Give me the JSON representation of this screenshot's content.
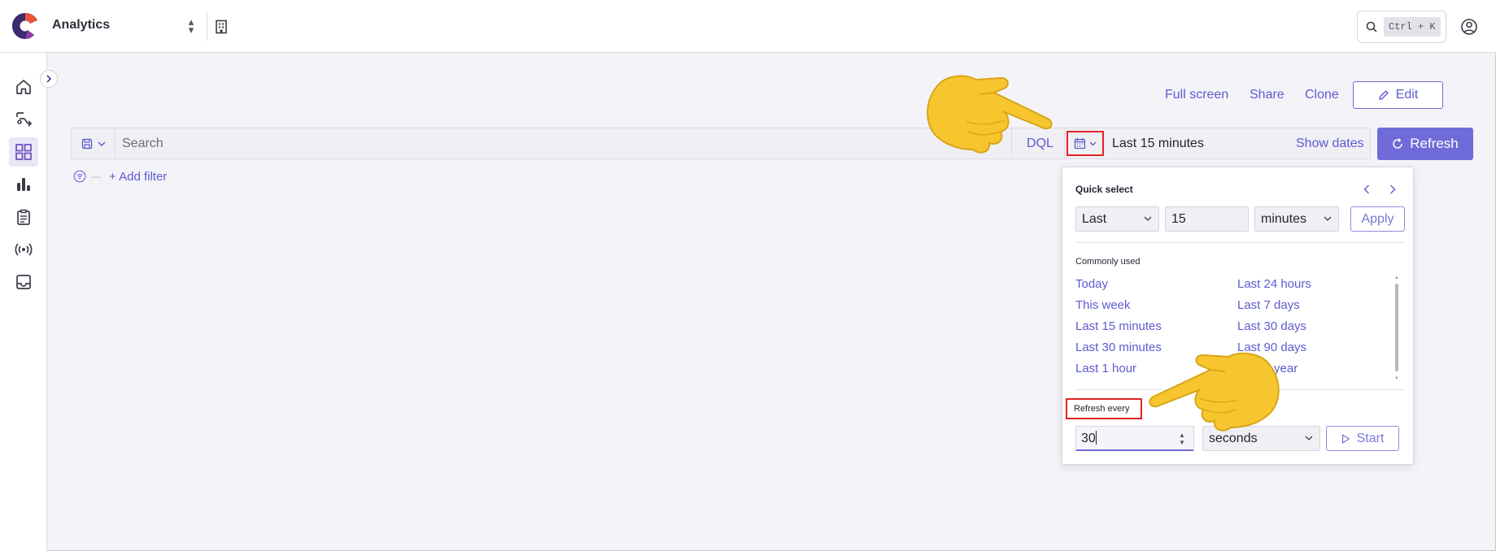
{
  "header": {
    "app_title": "Analytics",
    "search_shortcut": "Ctrl + K"
  },
  "nav": {
    "items": [
      {
        "icon": "home-icon"
      },
      {
        "icon": "flow-icon"
      },
      {
        "icon": "dashboard-icon",
        "active": true
      },
      {
        "icon": "bar-chart-icon"
      },
      {
        "icon": "clipboard-icon"
      },
      {
        "icon": "broadcast-icon"
      },
      {
        "icon": "inbox-icon"
      }
    ]
  },
  "actions": {
    "full_screen": "Full screen",
    "share": "Share",
    "clone": "Clone",
    "edit": "Edit"
  },
  "query": {
    "search_placeholder": "Search",
    "language": "DQL"
  },
  "time": {
    "range_label": "Last 15 minutes",
    "show_dates": "Show dates",
    "refresh": "Refresh"
  },
  "filters": {
    "add_filter": "+ Add filter"
  },
  "popover": {
    "quick_select_title": "Quick select",
    "quick_select": {
      "direction": "Last",
      "amount": "15",
      "unit": "minutes",
      "apply": "Apply"
    },
    "commonly_used_title": "Commonly used",
    "commonly_used": [
      "Today",
      "This week",
      "Last 15 minutes",
      "Last 30 minutes",
      "Last 1 hour",
      "Last 24 hours",
      "Last 7 days",
      "Last 30 days",
      "Last 90 days",
      "Last 1 year"
    ],
    "refresh_every_title": "Refresh every",
    "refresh_interval": "30",
    "refresh_unit": "seconds",
    "start": "Start"
  },
  "colors": {
    "accent": "#6f6cd9",
    "link": "#5e5bd0",
    "highlight": "#e02424"
  }
}
